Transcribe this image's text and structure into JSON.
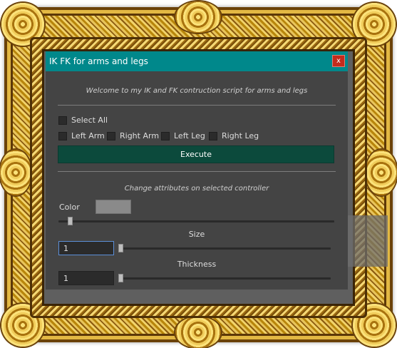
{
  "window": {
    "title": "IK FK for arms and legs",
    "close_label": "x"
  },
  "main": {
    "welcome": "Welcome to my IK and FK contruction script for arms and legs",
    "select_all_label": "Select All",
    "checkboxes": [
      {
        "label": "Left Arm",
        "checked": false
      },
      {
        "label": "Right Arm",
        "checked": false
      },
      {
        "label": "Left Leg",
        "checked": false
      },
      {
        "label": "Right Leg",
        "checked": false
      }
    ],
    "select_all_checked": false,
    "execute_label": "Execute"
  },
  "attributes": {
    "subtitle": "Change attributes on selected controller",
    "color_label": "Color",
    "color_value": "#8a8a8a",
    "size_label": "Size",
    "size_value": "1",
    "thickness_label": "Thickness",
    "thickness_value": "1"
  }
}
